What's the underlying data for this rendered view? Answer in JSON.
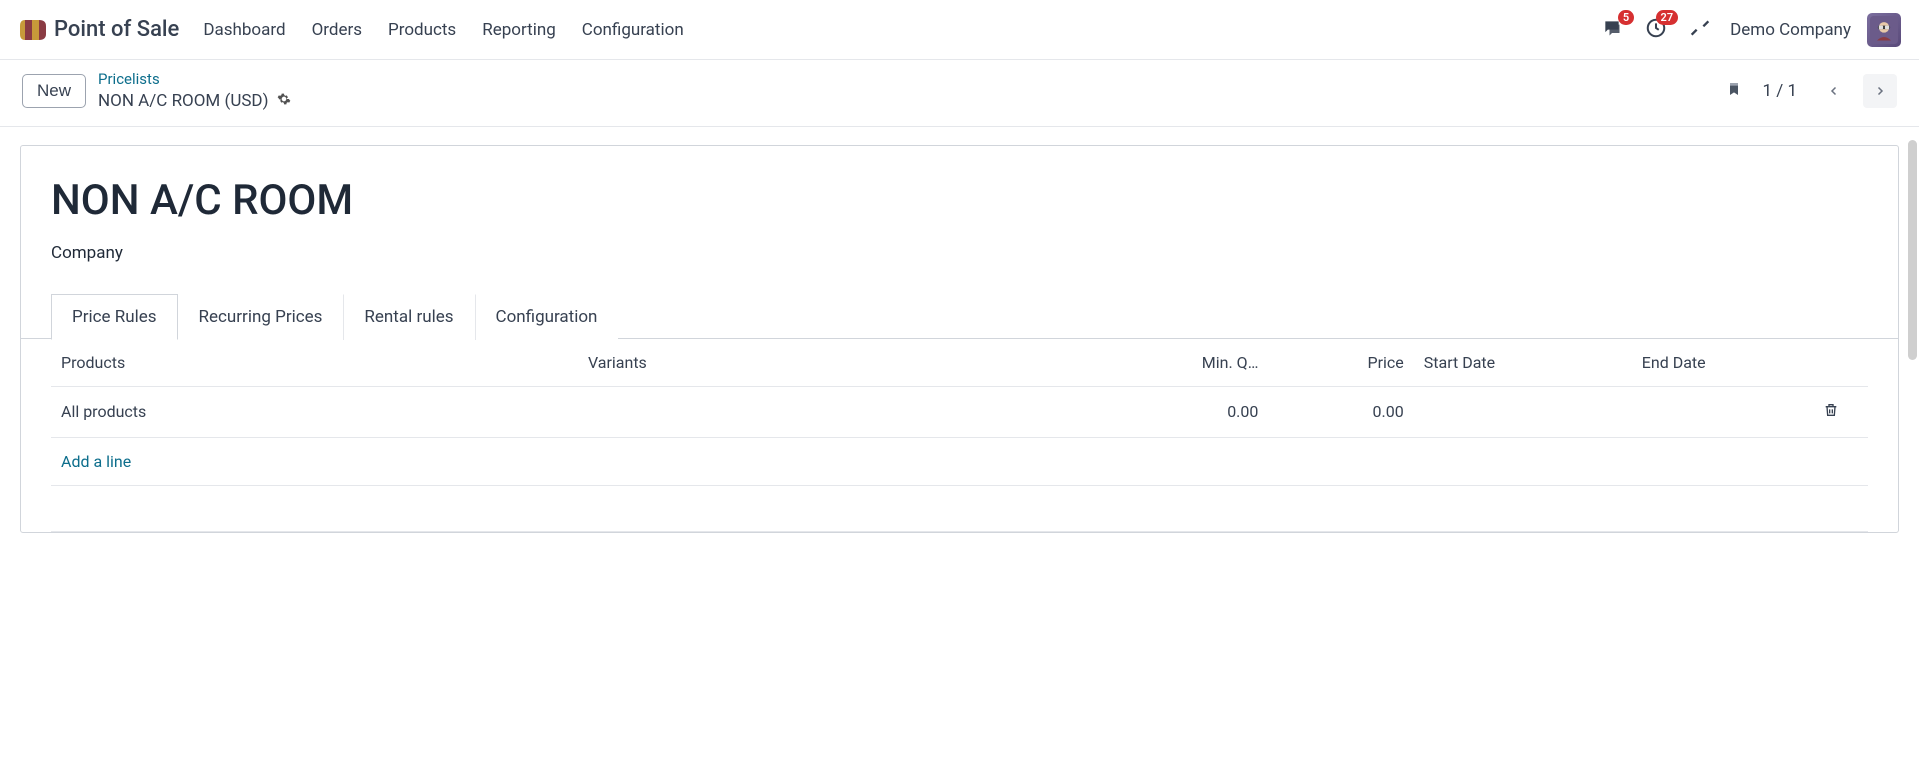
{
  "app": {
    "name": "Point of Sale"
  },
  "nav": {
    "items": [
      "Dashboard",
      "Orders",
      "Products",
      "Reporting",
      "Configuration"
    ]
  },
  "header": {
    "chat_badge": "5",
    "clock_badge": "27",
    "company": "Demo Company"
  },
  "actionbar": {
    "new_label": "New",
    "breadcrumb_parent": "Pricelists",
    "breadcrumb_current": "NON A/C ROOM (USD)",
    "pager": "1 / 1"
  },
  "record": {
    "title": "NON A/C ROOM",
    "company_label": "Company"
  },
  "tabs": {
    "items": [
      "Price Rules",
      "Recurring Prices",
      "Rental rules",
      "Configuration"
    ],
    "active": 0
  },
  "table": {
    "columns": {
      "products": "Products",
      "variants": "Variants",
      "min_qty": "Min. Q…",
      "price": "Price",
      "start_date": "Start Date",
      "end_date": "End Date"
    },
    "rows": [
      {
        "products": "All products",
        "variants": "",
        "min_qty": "0.00",
        "price": "0.00",
        "start_date": "",
        "end_date": ""
      }
    ],
    "add_line": "Add a line"
  }
}
